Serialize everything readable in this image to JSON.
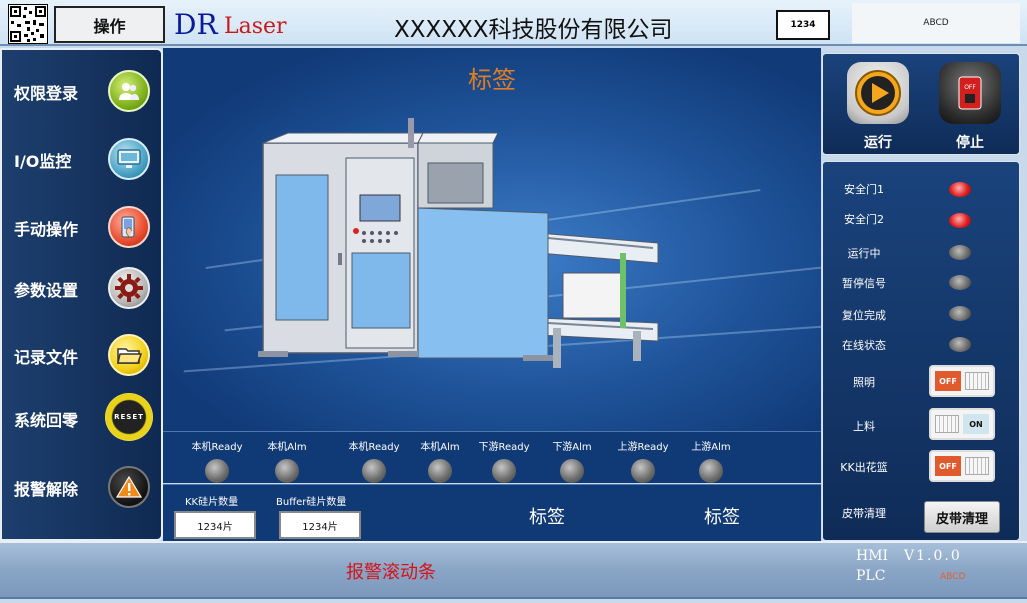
{
  "header": {
    "operate_label": "操作",
    "brand_dr": "DR",
    "brand_laser": "Laser",
    "company_name": "XXXXXX科技股份有限公司",
    "id_box_value": "1234",
    "top_right_value": "ABCD"
  },
  "sidebar": {
    "items": [
      {
        "label": "权限登录",
        "icon": "users-icon"
      },
      {
        "label": "I/O监控",
        "icon": "monitor-icon"
      },
      {
        "label": "手动操作",
        "icon": "hand-icon"
      },
      {
        "label": "参数设置",
        "icon": "gear-icon"
      },
      {
        "label": "记录文件",
        "icon": "folder-icon"
      },
      {
        "label": "系统回零",
        "icon": "reset-icon",
        "icon_text": "RESET"
      },
      {
        "label": "报警解除",
        "icon": "warning-icon"
      }
    ]
  },
  "main": {
    "title": "标签"
  },
  "status_signals": [
    {
      "label": "本机Ready"
    },
    {
      "label": "本机Alm"
    },
    {
      "label": "本机Ready"
    },
    {
      "label": "本机Alm"
    },
    {
      "label": "下游Ready"
    },
    {
      "label": "下游Alm"
    },
    {
      "label": "上游Ready"
    },
    {
      "label": "上游Alm"
    }
  ],
  "counts": {
    "kk_label": "KK硅片数量",
    "kk_value": "1234片",
    "buffer_label": "Buffer硅片数量",
    "buffer_value": "1234片",
    "tag1": "标签",
    "tag2": "标签"
  },
  "controls": {
    "run_label": "运行",
    "stop_label": "停止",
    "stop_icon_text": "OFF"
  },
  "signals": [
    {
      "label": "安全门1",
      "state": "red"
    },
    {
      "label": "安全门2",
      "state": "red"
    },
    {
      "label": "运行中",
      "state": "gray"
    },
    {
      "label": "暂停信号",
      "state": "gray"
    },
    {
      "label": "复位完成",
      "state": "gray"
    },
    {
      "label": "在线状态",
      "state": "gray"
    }
  ],
  "toggles": [
    {
      "label": "照明",
      "state_text": "OFF"
    },
    {
      "label": "上料",
      "state_text": "ON"
    },
    {
      "label": "KK出花篮",
      "state_text": "OFF"
    }
  ],
  "belt": {
    "label": "皮带清理",
    "button_label": "皮带清理"
  },
  "footer": {
    "alarm_text": "报警滚动条",
    "hmi_label": "HMI",
    "plc_label": "PLC",
    "version": "V1.0.0",
    "plc_value": "ABCD"
  },
  "colors": {
    "accent_orange": "#e07d1e",
    "alarm_red": "#d4141a",
    "panel_blue": "#0f2c58"
  }
}
